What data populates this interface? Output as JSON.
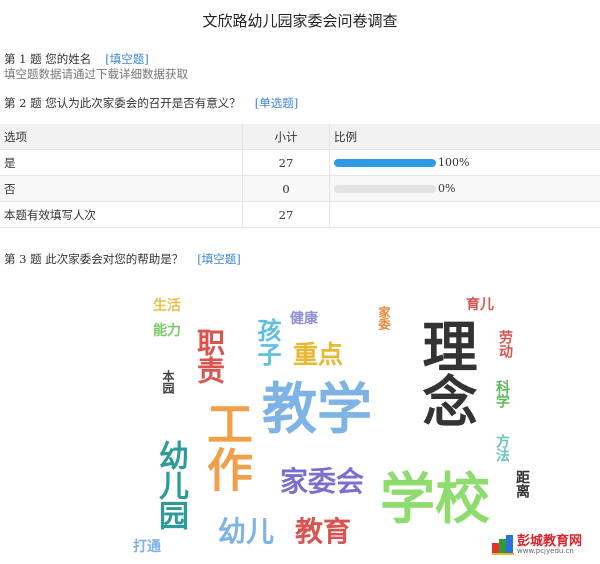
{
  "title": "文欣路幼儿园家委会问卷调查",
  "q1": {
    "label": "第 1 题   您的姓名",
    "type": "[填空题]",
    "hint": "填空题数据请通过下载详细数据获取"
  },
  "q2": {
    "label": "第 2 题   您认为此次家委会的召开是否有意义？",
    "type": "[单选题]",
    "headers": {
      "option": "选项",
      "count": "小计",
      "ratio": "比例"
    },
    "rows": [
      {
        "option": "是",
        "count": "27",
        "percent": "100%",
        "fraction": 1.0
      },
      {
        "option": "否",
        "count": "0",
        "percent": "0%",
        "fraction": 0.0
      }
    ],
    "total": {
      "label": "本题有效填写人次",
      "count": "27"
    },
    "bar_color": "#2d9be8"
  },
  "q3": {
    "label": "第 3 题   此次家委会对您的帮助是？",
    "type": "[填空题]"
  },
  "wordcloud": {
    "words": [
      {
        "text": "生活",
        "color": "#e8c24a"
      },
      {
        "text": "能力",
        "color": "#7ec96b"
      },
      {
        "text": "健康",
        "color": "#8f8fd8"
      },
      {
        "text": "家委",
        "color": "#e88a3a"
      },
      {
        "text": "育儿",
        "color": "#d9534f"
      },
      {
        "text": "孩子",
        "color": "#5bc0de"
      },
      {
        "text": "职责",
        "color": "#d9534f"
      },
      {
        "text": "重点",
        "color": "#e8b830"
      },
      {
        "text": "劳动",
        "color": "#d9534f"
      },
      {
        "text": "本园",
        "color": "#444444"
      },
      {
        "text": "理念",
        "color": "#333333"
      },
      {
        "text": "教学",
        "color": "#7fb2e5"
      },
      {
        "text": "工作",
        "color": "#f0a04b"
      },
      {
        "text": "科学",
        "color": "#5cb85c"
      },
      {
        "text": "方法",
        "color": "#6cc6c0"
      },
      {
        "text": "幼儿园",
        "color": "#2e9b9b"
      },
      {
        "text": "家委会",
        "color": "#7a6fcf"
      },
      {
        "text": "学校",
        "color": "#8fdc6e"
      },
      {
        "text": "距离",
        "color": "#333333"
      },
      {
        "text": "幼儿",
        "color": "#7fb2e5"
      },
      {
        "text": "教育",
        "color": "#d9534f"
      },
      {
        "text": "打通",
        "color": "#7fb2e5"
      }
    ]
  },
  "logo": {
    "name": "彭城教育网",
    "url": "www.pcjyedu.cn"
  }
}
